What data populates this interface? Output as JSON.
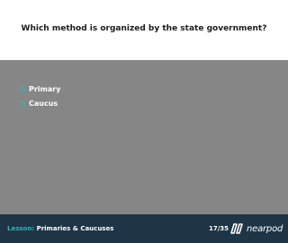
{
  "question": {
    "text": "Which method is organized by the state government?"
  },
  "options": [
    {
      "label": "Primary"
    },
    {
      "label": "Caucus"
    }
  ],
  "footer": {
    "lesson_prefix": "Lesson:",
    "lesson_name": "Primaries & Caucuses",
    "page_count": "17/35",
    "logo_text": "nearpod"
  },
  "colors": {
    "accent": "#39b3b0",
    "footer_bg": "#1e3447",
    "answers_bg": "#868686"
  }
}
